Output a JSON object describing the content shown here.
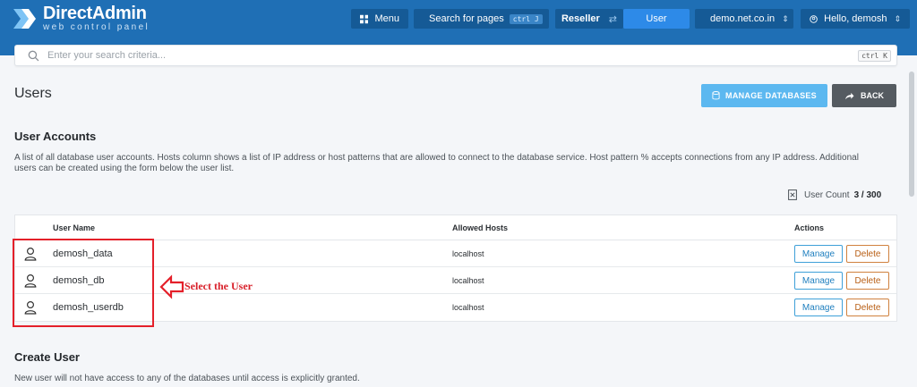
{
  "header": {
    "brand_title": "DirectAdmin",
    "brand_subtitle": "web control panel",
    "menu_label": "Menu",
    "search_pages_label": "Search for pages",
    "search_pages_shortcut": "ctrl J",
    "mode_reseller": "Reseller",
    "mode_user": "User",
    "domain_label": "demo.net.co.in",
    "greeting_label": "Hello, demosh"
  },
  "search": {
    "placeholder": "Enter your search criteria...",
    "shortcut": "ctrl K"
  },
  "page": {
    "title": "Users",
    "manage_db_label": "MANAGE DATABASES",
    "back_label": "BACK"
  },
  "accounts": {
    "title": "User Accounts",
    "description": "A list of all database user accounts. Hosts column shows a list of IP address or host patterns that are allowed to connect to the database service. Host pattern % accepts connections from any IP address. Additional users can be created using the form below the user list.",
    "count_label": "User Count",
    "count_value": "3 / 300"
  },
  "table": {
    "headers": {
      "name": "User Name",
      "hosts": "Allowed Hosts",
      "actions": "Actions"
    },
    "rows": [
      {
        "name": "demosh_data",
        "host": "localhost",
        "manage": "Manage",
        "delete": "Delete"
      },
      {
        "name": "demosh_db",
        "host": "localhost",
        "manage": "Manage",
        "delete": "Delete"
      },
      {
        "name": "demosh_userdb",
        "host": "localhost",
        "manage": "Manage",
        "delete": "Delete"
      }
    ]
  },
  "annotation": {
    "text": "Select the User"
  },
  "create": {
    "title": "Create User",
    "description": "New user will not have access to any of the databases until access is explicitly granted."
  },
  "colors": {
    "header_bg": "#1f6fb5",
    "accent_blue": "#2d8ae8",
    "annotation_red": "#e4202a"
  }
}
